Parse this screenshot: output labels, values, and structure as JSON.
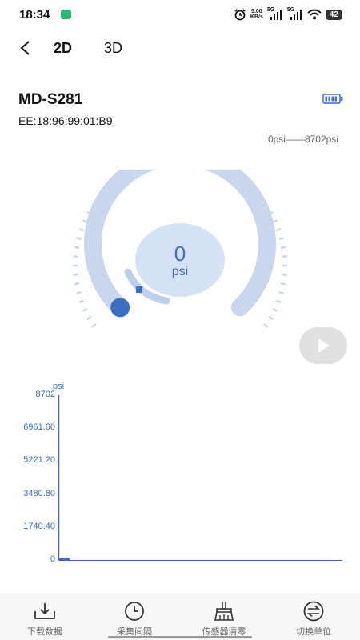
{
  "status_bar": {
    "time": "18:34",
    "net_speed_value": "5.00",
    "net_speed_unit": "KB/s",
    "sig1_label": "5G",
    "sig2_label": "5G",
    "battery": "42"
  },
  "nav": {
    "tab_2d": "2D",
    "tab_3d": "3D"
  },
  "device": {
    "name": "MD-S281",
    "mac": "EE:18:96:99:01:B9",
    "range": "0psi——8702psi"
  },
  "gauge": {
    "value": "0",
    "unit": "psi",
    "level": 0,
    "track_color": "#c9d6ee",
    "accent_color": "#3d6ec2"
  },
  "chart_data": {
    "type": "line",
    "ylabel": "psi",
    "ylim": [
      0,
      8702
    ],
    "y_ticks": [
      "8702",
      "6961.60",
      "5221.20",
      "3480.80",
      "1740.40",
      "0"
    ],
    "series": [
      {
        "values": [
          0,
          0
        ]
      }
    ]
  },
  "bottom_bar": {
    "items": [
      {
        "label": "下载数据",
        "icon": "download-icon"
      },
      {
        "label": "采集间隔",
        "icon": "clock-icon"
      },
      {
        "label": "传感器清零",
        "icon": "broom-icon"
      },
      {
        "label": "切换单位",
        "icon": "swap-icon"
      }
    ]
  }
}
